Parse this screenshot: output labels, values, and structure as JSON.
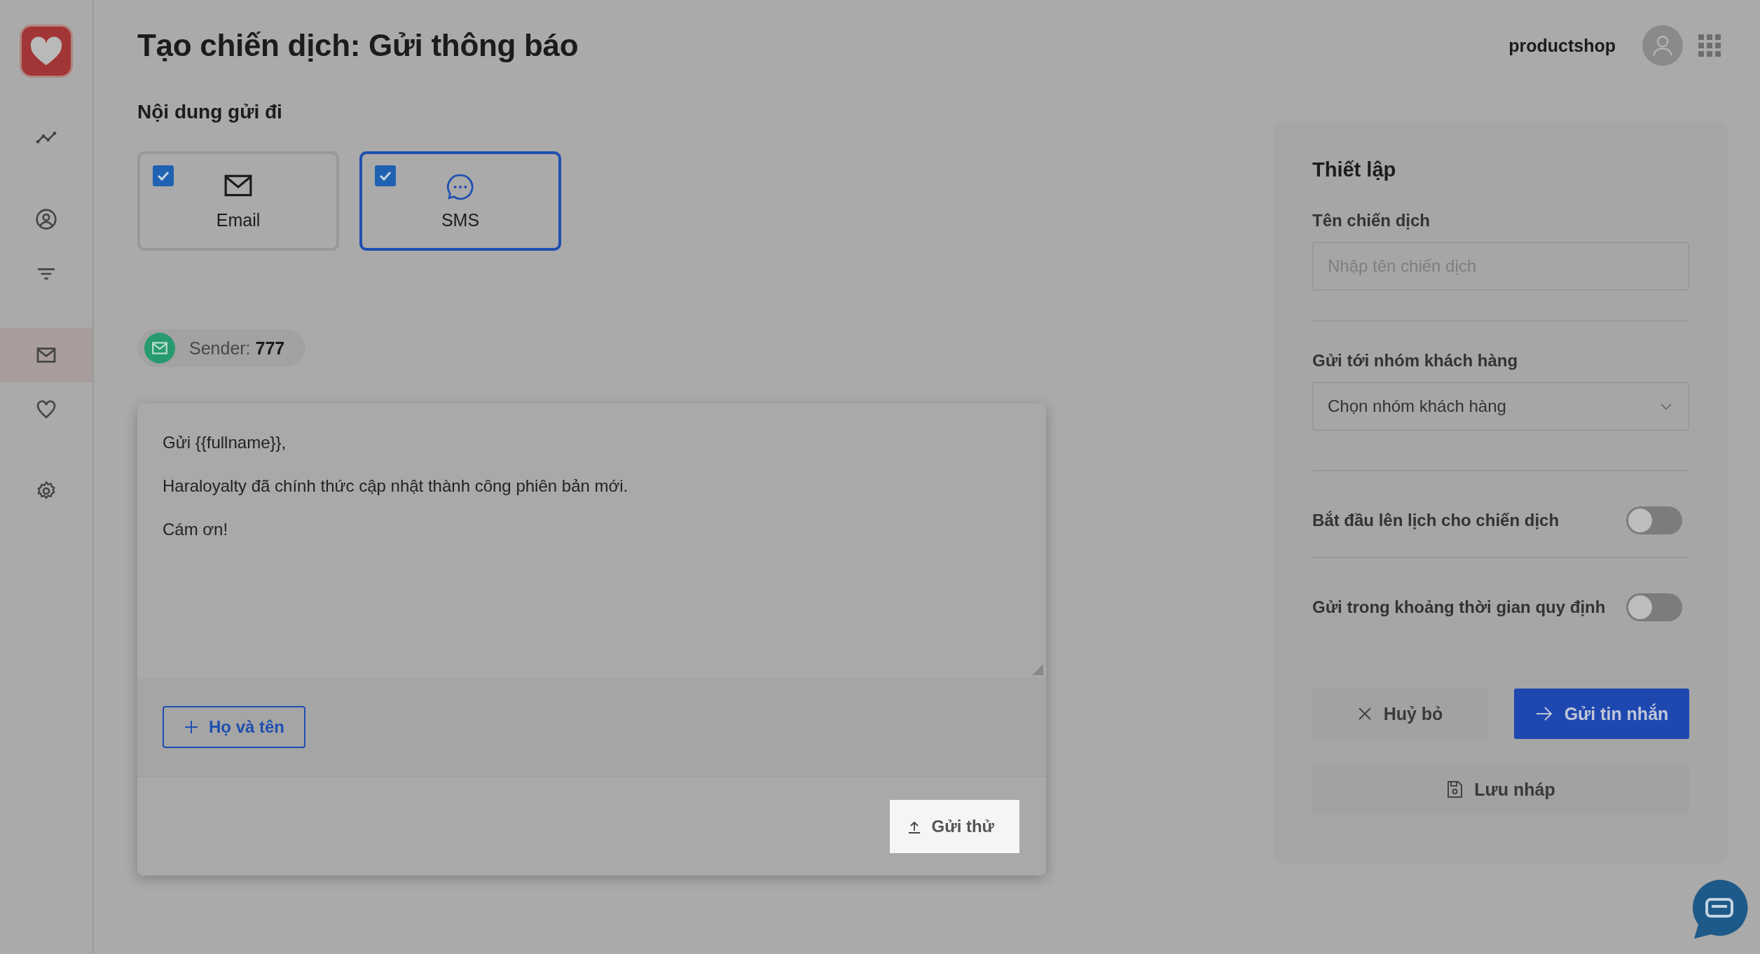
{
  "sidebar": {
    "items": [
      {
        "kind": "chart",
        "selected": false
      },
      {
        "kind": "user",
        "selected": false
      },
      {
        "kind": "filter",
        "selected": false
      },
      {
        "kind": "mail",
        "selected": true
      },
      {
        "kind": "heart",
        "selected": false
      },
      {
        "kind": "gear",
        "selected": false
      }
    ]
  },
  "header": {
    "title": "Tạo chiến dịch: Gửi thông báo",
    "shop_name": "productshop"
  },
  "content": {
    "section_title": "Nội dung gửi đi",
    "channels": [
      {
        "kind": "email",
        "label": "Email",
        "checked": true,
        "selected": false
      },
      {
        "kind": "sms",
        "label": "SMS",
        "checked": true,
        "selected": true
      }
    ],
    "sender": {
      "label": "Sender:",
      "value": "777"
    },
    "message_lines": [
      "Gửi {{fullname}},",
      "Haraloyalty đã chính thức cập nhật thành công phiên bản mới.",
      "Cám ơn!"
    ],
    "tag_buttons": [
      {
        "label": "Họ và tên"
      }
    ],
    "test_button": "Gửi thử"
  },
  "settings": {
    "title": "Thiết lập",
    "campaign_name": {
      "label": "Tên chiến dịch",
      "placeholder": "Nhập tên chiến dịch"
    },
    "customer_group": {
      "label": "Gửi tới nhóm khách hàng",
      "placeholder": "Chọn nhóm khách hàng"
    },
    "toggles": [
      {
        "label": "Bắt đầu lên lịch cho chiến dịch",
        "on": false
      },
      {
        "label": "Gửi trong khoảng thời gian quy định",
        "on": false
      }
    ],
    "cancel_button": "Huỷ bỏ",
    "send_button": "Gửi tin nhắn",
    "draft_button": "Lưu nháp"
  }
}
